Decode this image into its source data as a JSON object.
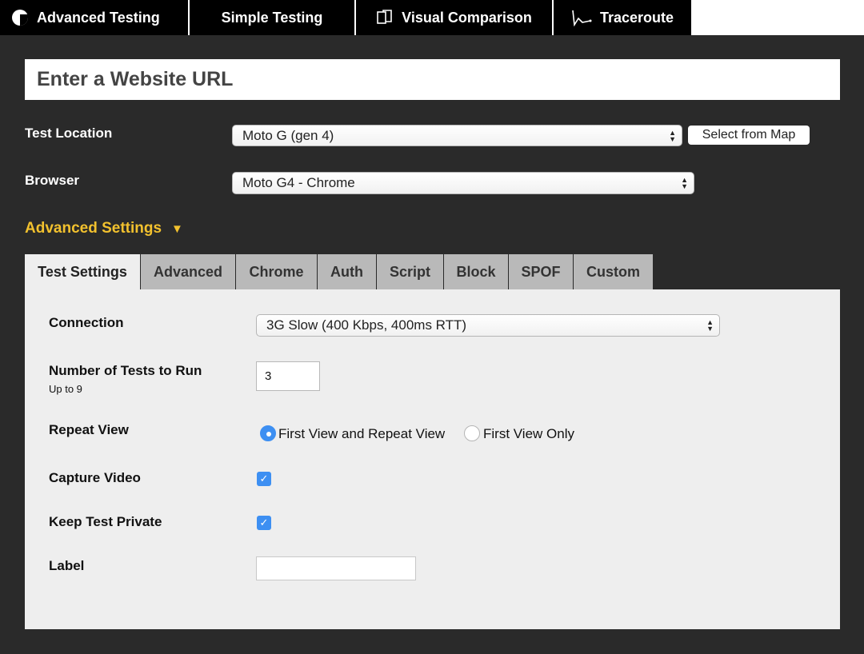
{
  "top_tabs": [
    {
      "label": "Advanced Testing",
      "icon": "webpagetest-logo-icon"
    },
    {
      "label": "Simple Testing"
    },
    {
      "label": "Visual Comparison",
      "icon": "compare-pages-icon"
    },
    {
      "label": "Traceroute",
      "icon": "traceroute-icon"
    }
  ],
  "url_input": {
    "placeholder": "Enter a Website URL",
    "value": ""
  },
  "test_location": {
    "label": "Test Location",
    "value": "Moto G (gen 4)",
    "map_button": "Select from Map"
  },
  "browser": {
    "label": "Browser",
    "value": "Moto G4 - Chrome"
  },
  "advanced_settings": {
    "label": "Advanced Settings",
    "toggle": "▼"
  },
  "settings_tabs": [
    "Test Settings",
    "Advanced",
    "Chrome",
    "Auth",
    "Script",
    "Block",
    "SPOF",
    "Custom"
  ],
  "test_settings": {
    "connection": {
      "label": "Connection",
      "value": "3G Slow (400 Kbps, 400ms RTT)"
    },
    "num_tests": {
      "label": "Number of Tests to Run",
      "sublabel": "Up to 9",
      "value": "3"
    },
    "repeat_view": {
      "label": "Repeat View",
      "options": [
        "First View and Repeat View",
        "First View Only"
      ],
      "selected": "First View and Repeat View"
    },
    "capture_video": {
      "label": "Capture Video",
      "checked": true
    },
    "keep_private": {
      "label": "Keep Test Private",
      "checked": true
    },
    "label_field": {
      "label": "Label",
      "value": ""
    }
  },
  "colors": {
    "background": "#2a2a2a",
    "accent": "#f2c12e",
    "checkbox_blue": "#3d8ff2",
    "tab_inactive": "#b9b9b9",
    "panel": "#eeeeee"
  }
}
